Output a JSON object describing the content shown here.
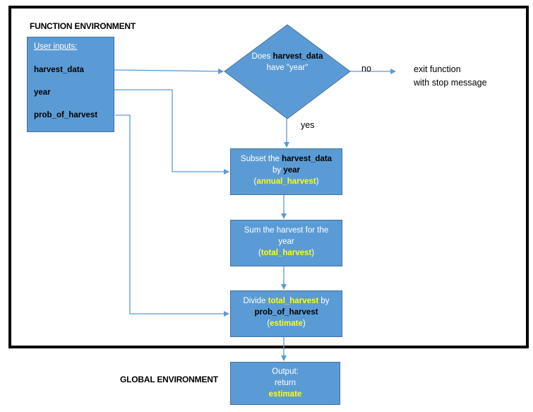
{
  "function_environment": {
    "label": "FUNCTION ENVIRONMENT",
    "inputs_box": {
      "header": "User inputs:",
      "items": [
        "harvest_data",
        "year",
        "prob_of_harvest"
      ]
    },
    "decision": {
      "line1": "Does",
      "line2": "harvest_data",
      "line3": "have \"year\"",
      "no_label": "no",
      "yes_label": "yes"
    },
    "exit": {
      "line1": "exit function",
      "line2": "with stop message"
    },
    "step1": {
      "prefix": "Subset the ",
      "var1": "harvest_data",
      "by": "by ",
      "var2": "year",
      "paren_open": "(",
      "result": "annual_harvest",
      "paren_close": ")"
    },
    "step2": {
      "line1": "Sum the harvest for the",
      "line2": "year",
      "paren_open": "(",
      "result": "total_harvest",
      "paren_close": ")"
    },
    "step3": {
      "prefix": "Divide ",
      "var1": "total_harvest",
      "suffix": " by",
      "var2": "prob_of_harvest",
      "paren_open": "(",
      "result": "estimate",
      "paren_close": ")"
    }
  },
  "global_environment": {
    "label": "GLOBAL ENVIRONMENT",
    "output": {
      "line1": "Output:",
      "line2": "return",
      "result": "estimate"
    }
  },
  "colors": {
    "box_fill": "#5b9bd5",
    "box_border": "#41719c",
    "highlight": "#ffff00",
    "frame": "#000000"
  }
}
